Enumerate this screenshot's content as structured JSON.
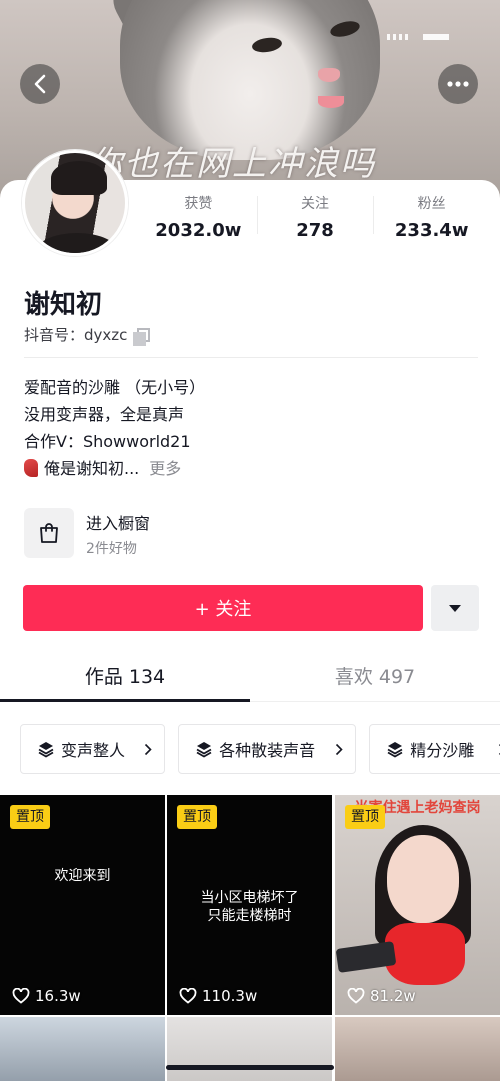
{
  "cover": {
    "caption": "你也在网上冲浪吗"
  },
  "stats": [
    {
      "label": "获赞",
      "value": "2032.0w"
    },
    {
      "label": "关注",
      "value": "278"
    },
    {
      "label": "粉丝",
      "value": "233.4w"
    }
  ],
  "profile": {
    "name": "谢知初",
    "douyin_id": "抖音号：dyxzc"
  },
  "bio": {
    "line1": "爱配音的沙雕 （无小号）",
    "line2": "没用变声器，全是真声",
    "line3": "合作V：Showworld21",
    "line4": "俺是谢知初...",
    "more": "更多"
  },
  "shop": {
    "title": "进入橱窗",
    "subtitle": "2件好物"
  },
  "follow_button": "+ 关注",
  "tabs": [
    {
      "label": "作品 134"
    },
    {
      "label": "喜欢 497"
    }
  ],
  "collections": [
    {
      "label": "变声整人"
    },
    {
      "label": "各种散装声音"
    },
    {
      "label": "精分沙雕"
    }
  ],
  "videos": [
    {
      "pinned": "置顶",
      "text": "欢迎来到",
      "likes": "16.3w"
    },
    {
      "pinned": "置顶",
      "text1": "当小区电梯坏了",
      "text2": "只能走楼梯时",
      "likes": "110.3w"
    },
    {
      "pinned": "置顶",
      "caption": "当寄住遇上老妈查岗",
      "likes": "81.2w"
    }
  ],
  "colors": {
    "accent": "#fe2c55",
    "pin_badge": "#facd15",
    "text_primary": "#161823",
    "text_secondary": "#8a8b91"
  },
  "icons": [
    "back-arrow-icon",
    "more-dots-icon",
    "copy-icon",
    "shopping-bag-icon",
    "triangle-down-icon",
    "stack-icon",
    "chevron-right-icon",
    "heart-icon",
    "scarf-emoji-icon"
  ]
}
